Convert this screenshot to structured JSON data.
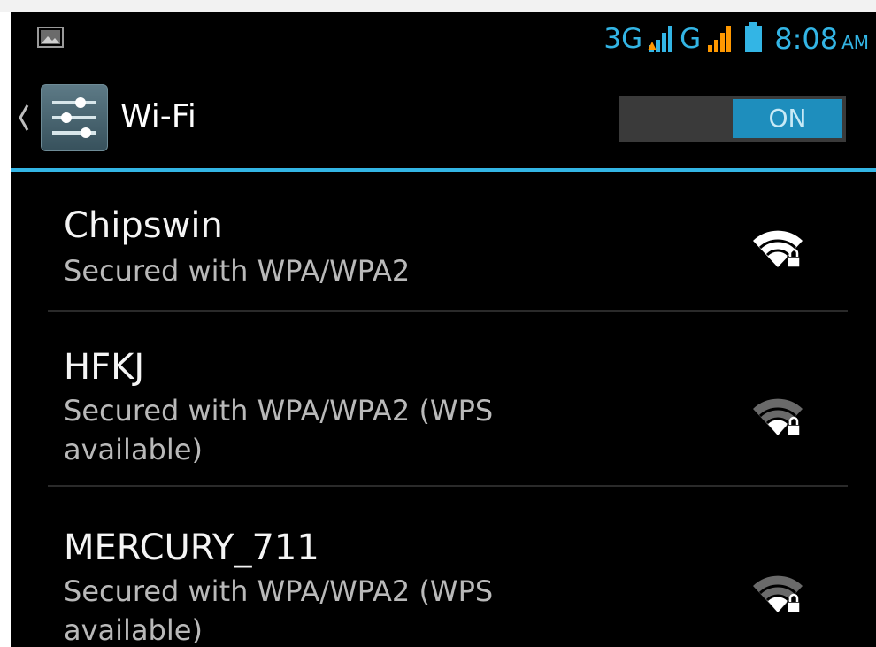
{
  "status_bar": {
    "net_3g": "3G",
    "net_g": "G",
    "time": "8:08",
    "ampm": "AM",
    "icons": [
      "image-notification-icon",
      "signal-3g-icon",
      "signal-g-icon",
      "battery-icon"
    ],
    "accent_color": "#33b5e5",
    "signal_warm_color": "#ff9800"
  },
  "action_bar": {
    "title": "Wi-Fi",
    "toggle_label": "ON",
    "toggle_on": true,
    "icons": [
      "back-chevron-icon",
      "settings-app-icon"
    ]
  },
  "networks": [
    {
      "ssid": "Chipswin",
      "security": "Secured with WPA/WPA2",
      "icon": "wifi-locked-icon"
    },
    {
      "ssid": "HFKJ",
      "security": "Secured with WPA/WPA2 (WPS available)",
      "icon": "wifi-locked-weak-icon"
    },
    {
      "ssid": "MERCURY_711",
      "security": "Secured with WPA/WPA2 (WPS available)",
      "icon": "wifi-locked-weak-icon"
    }
  ]
}
